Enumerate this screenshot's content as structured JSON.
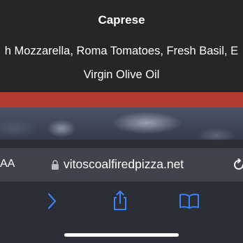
{
  "menu": {
    "item_title": "Caprese",
    "item_description_line1": "h Mozzarella, Roma Tomatoes, Fresh Basil, E",
    "item_description_line2": "Virgin Olive Oil"
  },
  "browser": {
    "text_size_label": "AA",
    "url": "vitoscoalfiredpizza.net",
    "icons": [
      "lock-icon",
      "reload-icon",
      "forward-icon",
      "share-icon",
      "bookmarks-icon"
    ]
  },
  "colors": {
    "accent_blue": "#3a82f7",
    "red_band": "#b43d32",
    "card_background": "#262626"
  }
}
